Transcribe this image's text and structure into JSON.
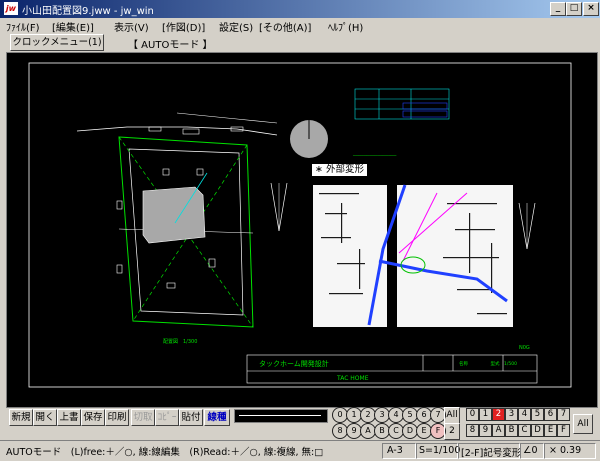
{
  "window": {
    "app_badge": "jw",
    "title": "小山田配置図9.jww - jw_win",
    "min": "_",
    "max": "□",
    "close": "×"
  },
  "menu": [
    "ﾌｧｲﾙ(F)",
    "[編集(E)]",
    "表示(V)",
    "[作図(D)]",
    "設定(S)",
    "[その他(A)]",
    "ﾍﾙﾌﾟ(H)"
  ],
  "toolbar": {
    "clock_menu": "クロックメニュー(1)",
    "mode": "【 AUTOモード 】"
  },
  "canvas": {
    "popup_label": "外部変形",
    "scale_left": "配置図　1/300",
    "title_block_name": "タックホーム開発設計",
    "title_block_footer": "TAC HOME",
    "note_text": "名称　　　　　型式　1/500",
    "north_label": "N0G",
    "colors": {
      "background": "#000000",
      "white": "#ffffff",
      "green": "#00e000",
      "gray": "#a8a8a8",
      "blue": "#2040ff",
      "magenta": "#ff00ff",
      "cyan": "#00e0e0"
    }
  },
  "commands": {
    "new": "新規",
    "open": "開く",
    "overwrite": "上書",
    "save": "保存",
    "print": "印刷",
    "cut": "切取",
    "copy": "ｺﾋﾟｰ",
    "paste": "貼付",
    "linetype": "線種"
  },
  "layer_groups": {
    "row1": [
      "0",
      "1",
      "2",
      "3",
      "4",
      "5",
      "6",
      "7"
    ],
    "row2": [
      "8",
      "9",
      "A",
      "B",
      "C",
      "D",
      "E",
      "F"
    ],
    "all": "All",
    "page": "2"
  },
  "layers": {
    "row1": [
      "0",
      "1",
      "2",
      "3",
      "4",
      "5",
      "6",
      "7"
    ],
    "row2": [
      "8",
      "9",
      "A",
      "B",
      "C",
      "D",
      "E",
      "F"
    ],
    "all": "All",
    "selected": "2"
  },
  "status": {
    "message": "AUTOモード　(L)free:＋／○, 線:線編集　(R)Read:＋／○, 線:複線, 無:□",
    "paper": "A-3",
    "scale": "S=1/100",
    "layer_info": "[2-F]記号変形",
    "angle": "∠0",
    "zoom": "× 0.39"
  }
}
